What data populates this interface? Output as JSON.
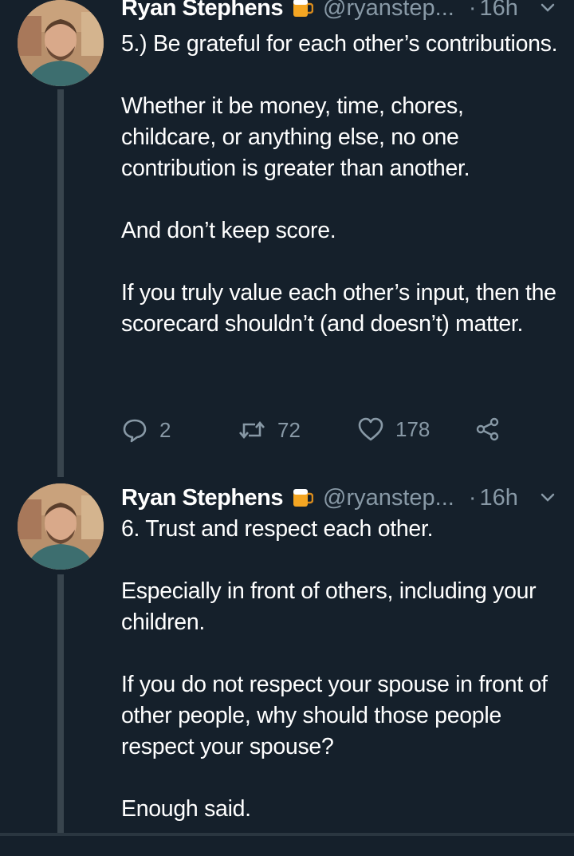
{
  "colors": {
    "background": "#15202b",
    "text_primary": "#ffffff",
    "text_secondary": "#8899a6",
    "thread_line": "#38444d"
  },
  "tweets": [
    {
      "author_name": "Ryan Stephens",
      "emoji_icon": "beer-mug-icon",
      "handle": "@ryanstep...",
      "separator": "·",
      "time": "16h",
      "paragraphs": [
        "5.) Be grateful for each other’s contributions.",
        "Whether it be money, time, chores, childcare, or anything else, no one contribution is greater than another.",
        "And don’t keep score.",
        "If you truly value each other’s input, then the scorecard shouldn’t (and doesn’t) matter."
      ],
      "actions": {
        "reply_count": "2",
        "retweet_count": "72",
        "like_count": "178"
      }
    },
    {
      "author_name": "Ryan Stephens",
      "emoji_icon": "beer-mug-icon",
      "handle": "@ryanstep...",
      "separator": "·",
      "time": "16h",
      "paragraphs": [
        "6. Trust and respect each other.",
        "Especially in front of others, including your children.",
        "If you do not respect your spouse in front of other people, why should those people respect your spouse?",
        "Enough said."
      ]
    }
  ]
}
